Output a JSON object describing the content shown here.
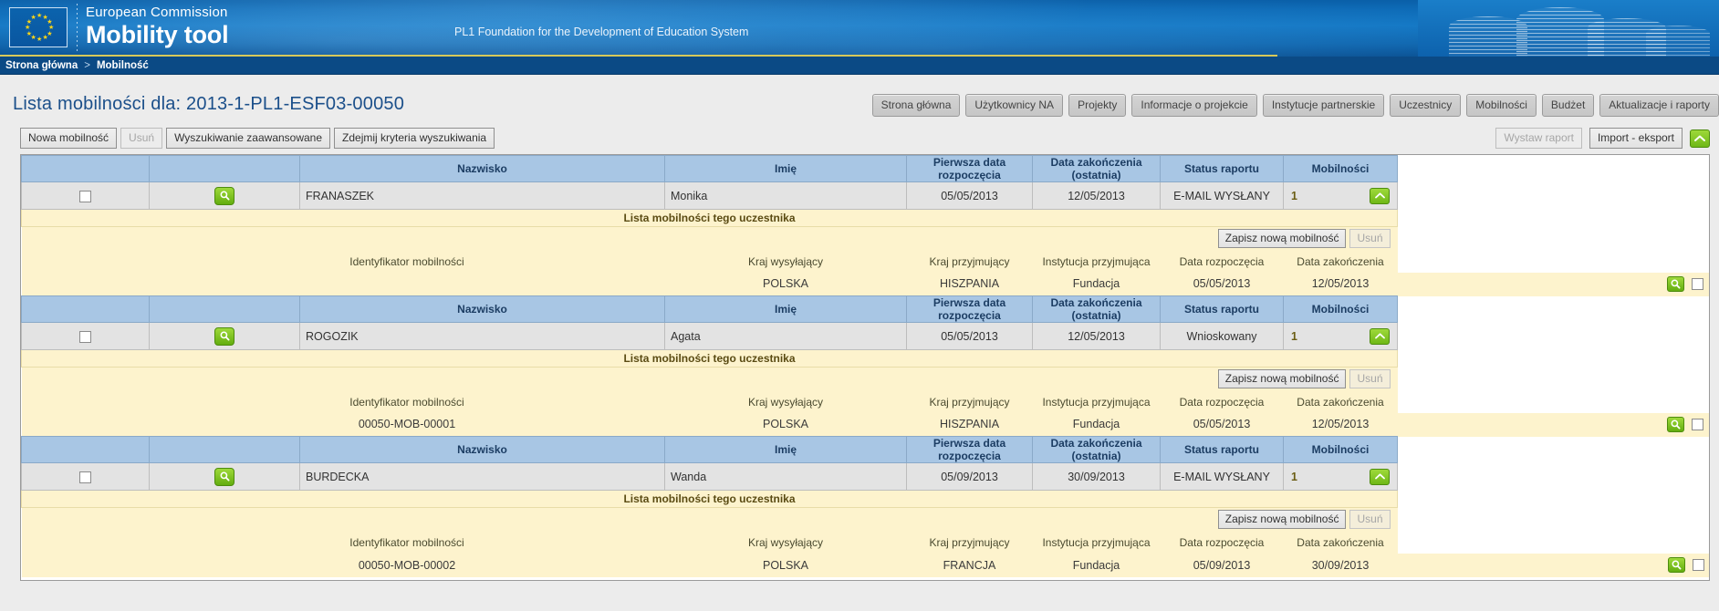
{
  "header": {
    "brand_top": "European Commission",
    "brand_main": "Mobility tool",
    "org_name": "PL1 Foundation for the Development of Education System",
    "flag_icon": "eu-flag-icon",
    "building_icon": "berlaymont-building-icon"
  },
  "breadcrumb": {
    "home": "Strona główna",
    "separator": ">",
    "current": "Mobilność"
  },
  "page": {
    "title": "Lista mobilności dla: 2013-1-PL1-ESF03-00050"
  },
  "nav_buttons": [
    {
      "label": "Strona główna"
    },
    {
      "label": "Użytkownicy NA"
    },
    {
      "label": "Projekty"
    },
    {
      "label": "Informacje o projekcie"
    },
    {
      "label": "Instytucje partnerskie"
    },
    {
      "label": "Uczestnicy"
    },
    {
      "label": "Mobilności"
    },
    {
      "label": "Budżet"
    },
    {
      "label": "Aktualizacje i raporty"
    }
  ],
  "toolbar": {
    "left": [
      {
        "label": "Nowa mobilność",
        "disabled": false
      },
      {
        "label": "Usuń",
        "disabled": true
      },
      {
        "label": "Wyszukiwanie zaawansowane",
        "disabled": false
      },
      {
        "label": "Zdejmij kryteria wyszukiwania",
        "disabled": false
      }
    ],
    "right": [
      {
        "label": "Wystaw raport",
        "disabled": true
      },
      {
        "label": "Import - eksport",
        "disabled": false
      }
    ],
    "collapse_icon": "chevron-up-icon"
  },
  "table": {
    "columns": [
      "Nazwisko",
      "Imię",
      "Pierwsza data rozpoczęcia",
      "Data zakończenia (ostatnia)",
      "Status raportu",
      "Mobilności"
    ],
    "sub_title": "Lista mobilności tego uczestnika",
    "sub_actions": [
      {
        "label": "Zapisz nową mobilność",
        "disabled": false
      },
      {
        "label": "Usuń",
        "disabled": true
      }
    ],
    "sub_columns": [
      "Identyfikator mobilności",
      "Kraj wysyłający",
      "Kraj przyjmujący",
      "Instytucja przyjmująca",
      "Data rozpoczęcia",
      "Data zakończenia"
    ],
    "rows": [
      {
        "surname": "FRANASZEK",
        "firstname": "Monika",
        "start": "05/05/2013",
        "end": "12/05/2013",
        "status": "E-MAIL WYSŁANY",
        "count": "1",
        "details": [
          {
            "id": "",
            "sending": "POLSKA",
            "receiving": "HISZPANIA",
            "institution": "Fundacja",
            "start": "05/05/2013",
            "end": "12/05/2013"
          }
        ]
      },
      {
        "surname": "ROGOZIK",
        "firstname": "Agata",
        "start": "05/05/2013",
        "end": "12/05/2013",
        "status": "Wnioskowany",
        "count": "1",
        "details": [
          {
            "id": "00050-MOB-00001",
            "sending": "POLSKA",
            "receiving": "HISZPANIA",
            "institution": "Fundacja",
            "start": "05/05/2013",
            "end": "12/05/2013"
          }
        ]
      },
      {
        "surname": "BURDECKA",
        "firstname": "Wanda",
        "start": "05/09/2013",
        "end": "30/09/2013",
        "status": "E-MAIL WYSŁANY",
        "count": "1",
        "details": [
          {
            "id": "00050-MOB-00002",
            "sending": "POLSKA",
            "receiving": "FRANCJA",
            "institution": "Fundacja",
            "start": "05/09/2013",
            "end": "30/09/2013"
          }
        ]
      }
    ],
    "row_icons": {
      "detail": "magnifier-icon",
      "select": "checkbox",
      "expand": "chevron-up-icon"
    }
  },
  "colors": {
    "banner_blue": "#0e6cb8",
    "crumb_blue": "#0b4a85",
    "title_blue": "#1b4f8a",
    "header_row": "#a8c6e4",
    "participant_row": "#e3e3e3",
    "detail_row": "#fdf3cd",
    "green_button": "#6fb817"
  }
}
